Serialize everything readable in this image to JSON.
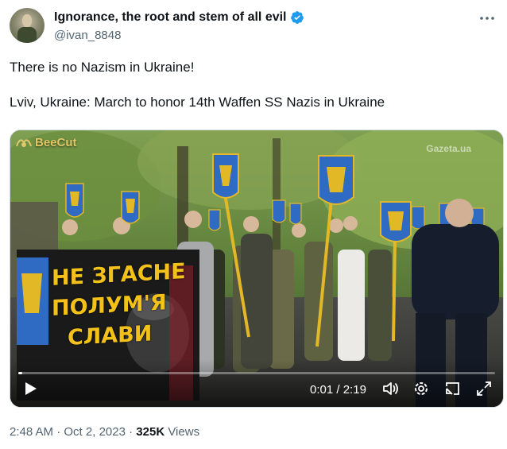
{
  "author": {
    "display_name": "Ignorance, the root and stem of all evil",
    "handle": "@ivan_8848",
    "verified": true
  },
  "tweet": {
    "line1": "There is no Nazism in Ukraine!",
    "line2": "Lviv, Ukraine: March to honor 14th Waffen SS Nazis in Ukraine"
  },
  "video": {
    "watermark": "BeeCut",
    "source_mark": "Gazeta.ua",
    "banner_text": [
      "НЕ ЗГАСНЕ",
      "ПОЛУМ'Я",
      "СЛАВИ"
    ],
    "current_time": "0:01",
    "separator": "/",
    "duration": "2:19",
    "progress_fraction": 0.008
  },
  "meta": {
    "time": "2:48 AM",
    "dot": "·",
    "date": "Oct 2, 2023",
    "dot2": "·",
    "views_count": "325K",
    "views_label": "Views"
  },
  "colors": {
    "verified": "#1d9bf0",
    "flag_blue": "#2f6bc2",
    "flag_gold": "#e3b826",
    "banner_yellow": "#f2c21b"
  },
  "icons": [
    "verified-badge-icon",
    "more-icon",
    "play-icon",
    "volume-icon",
    "settings-icon",
    "pip-icon",
    "fullscreen-icon",
    "bee-icon"
  ]
}
